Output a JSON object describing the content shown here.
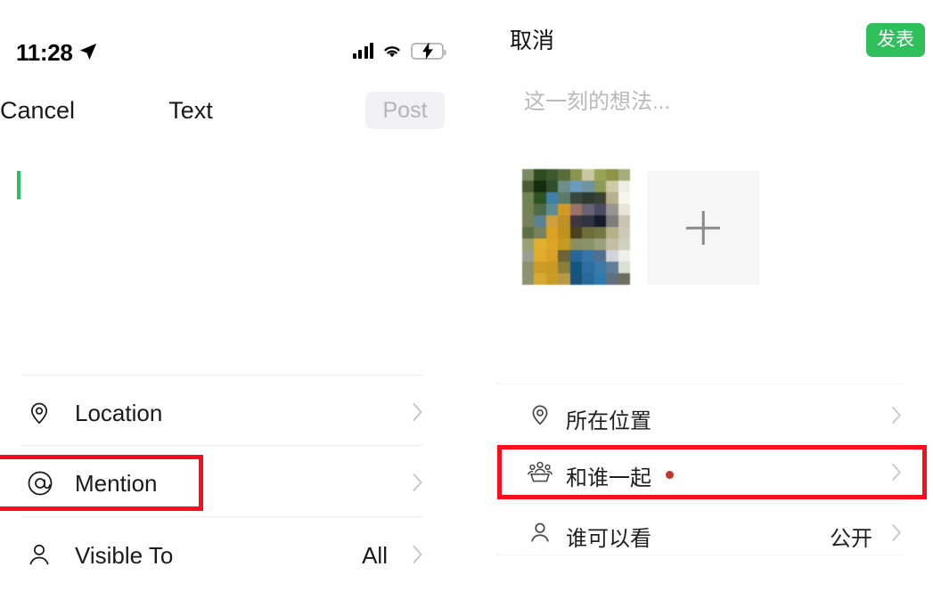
{
  "left_panel": {
    "status_bar": {
      "time": "11:28",
      "location_icon": "location-arrow-icon",
      "signal_icon": "cellular-signal-icon",
      "wifi_icon": "wifi-icon",
      "battery_icon": "battery-charging-icon",
      "battery_color": "#2ECC64"
    },
    "nav": {
      "cancel_label": "Cancel",
      "title": "Text",
      "post_label": "Post",
      "post_enabled": false,
      "post_bg": "#f1f1f3",
      "post_text_color": "#b4b4b8"
    },
    "composer": {
      "caret_color": "#27c160",
      "text": ""
    },
    "options": [
      {
        "icon": "location-pin-icon",
        "label": "Location",
        "value": "",
        "chevron": "chevron-right-icon",
        "highlighted": false
      },
      {
        "icon": "at-sign-icon",
        "label": "Mention",
        "value": "",
        "chevron": "chevron-right-icon",
        "highlighted": true
      },
      {
        "icon": "person-icon",
        "label": "Visible To",
        "value": "All",
        "chevron": "chevron-right-icon",
        "highlighted": false
      }
    ]
  },
  "right_panel": {
    "nav": {
      "cancel_label": "取消",
      "publish_label": "发表",
      "publish_bg": "#2fbf5b",
      "publish_text_color": "#ffffff"
    },
    "composer": {
      "placeholder": "这一刻的想法...",
      "text": ""
    },
    "media": {
      "thumbnail_alt": "pixelated-photo-thumbnail",
      "add_photo_icon": "plus-icon"
    },
    "options": [
      {
        "icon": "location-pin-icon",
        "label": "所在位置",
        "value": "",
        "dot": false,
        "chevron": "chevron-right-icon",
        "highlighted": false
      },
      {
        "icon": "group-people-icon",
        "label": "和谁一起",
        "value": "",
        "dot": true,
        "chevron": "chevron-right-icon",
        "highlighted": true
      },
      {
        "icon": "person-icon",
        "label": "谁可以看",
        "value": "公开",
        "dot": false,
        "chevron": "chevron-right-icon",
        "highlighted": false
      }
    ]
  },
  "annotations": {
    "highlight_color": "#fc0d1b",
    "boxes": [
      {
        "target": "Mention"
      },
      {
        "target": "和谁一起"
      }
    ]
  }
}
